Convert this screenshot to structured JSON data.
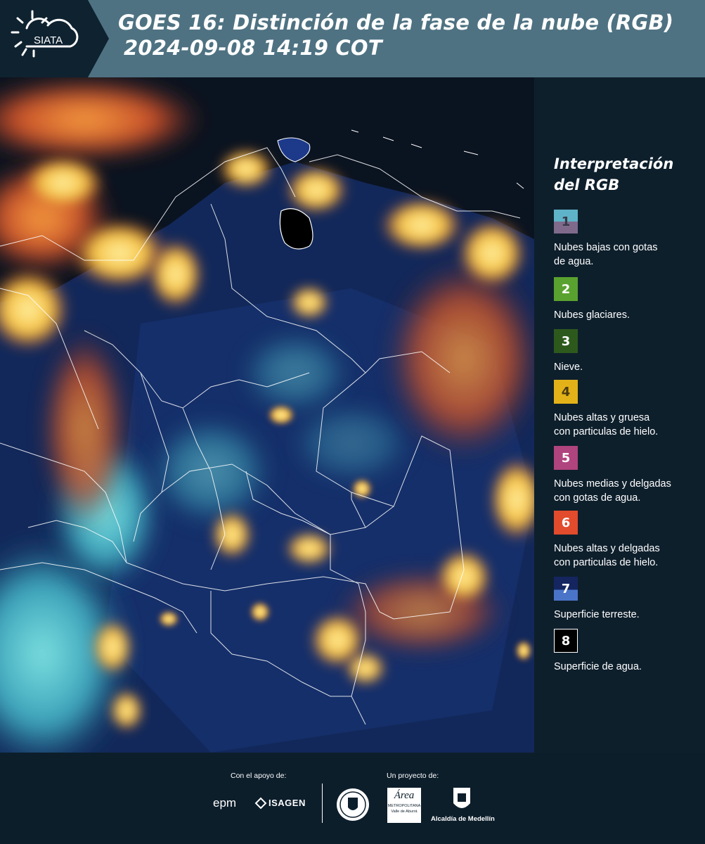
{
  "header": {
    "logo_text": "SIATA",
    "title_line1": "GOES 16: Distinción de la fase de la nube (RGB)",
    "title_line2": "2024-09-08 14:19 COT",
    "background_color": "#4e7282"
  },
  "legend": {
    "title_line1": "Interpretación",
    "title_line2": "del RGB",
    "items": [
      {
        "number": "1",
        "label_lines": [
          "Nubes bajas con gotas",
          "de agua."
        ],
        "color_top": "#5fb3c8",
        "color_bottom": "#7f6a8c"
      },
      {
        "number": "2",
        "label_lines": [
          "Nubes glaciares."
        ],
        "color_top": "#5aa22f",
        "color_bottom": "#5aa22f"
      },
      {
        "number": "3",
        "label_lines": [
          "Nieve."
        ],
        "color_top": "#2d5a1c",
        "color_bottom": "#2d5a1c"
      },
      {
        "number": "4",
        "label_lines": [
          "Nubes altas y gruesa",
          "con particulas de hielo."
        ],
        "color_top": "#e2b218",
        "color_bottom": "#e2b218"
      },
      {
        "number": "5",
        "label_lines": [
          "Nubes medias y delgadas",
          "con gotas de agua."
        ],
        "color_top": "#b0447e",
        "color_bottom": "#b0447e"
      },
      {
        "number": "6",
        "label_lines": [
          "Nubes altas y delgadas",
          "con particulas de hielo."
        ],
        "color_top": "#e24b2c",
        "color_bottom": "#e24b2c"
      },
      {
        "number": "7",
        "label_lines": [
          "Superficie terreste."
        ],
        "color_top": "#142560",
        "color_bottom": "#4a74c8"
      },
      {
        "number": "8",
        "label_lines": [
          "Superficie de agua."
        ],
        "color_top": "#000000",
        "color_bottom": "#000000"
      }
    ]
  },
  "footer": {
    "support_label": "Con el apoyo de:",
    "project_label": "Un proyecto de:",
    "sponsor1": "epm",
    "sponsor2": "ISAGEN",
    "partner1_line1": "Área",
    "partner1_line2": "METROPOLITANA",
    "partner1_line3": "Valle de Aburrá",
    "partner2": "Alcaldía de Medellín"
  }
}
